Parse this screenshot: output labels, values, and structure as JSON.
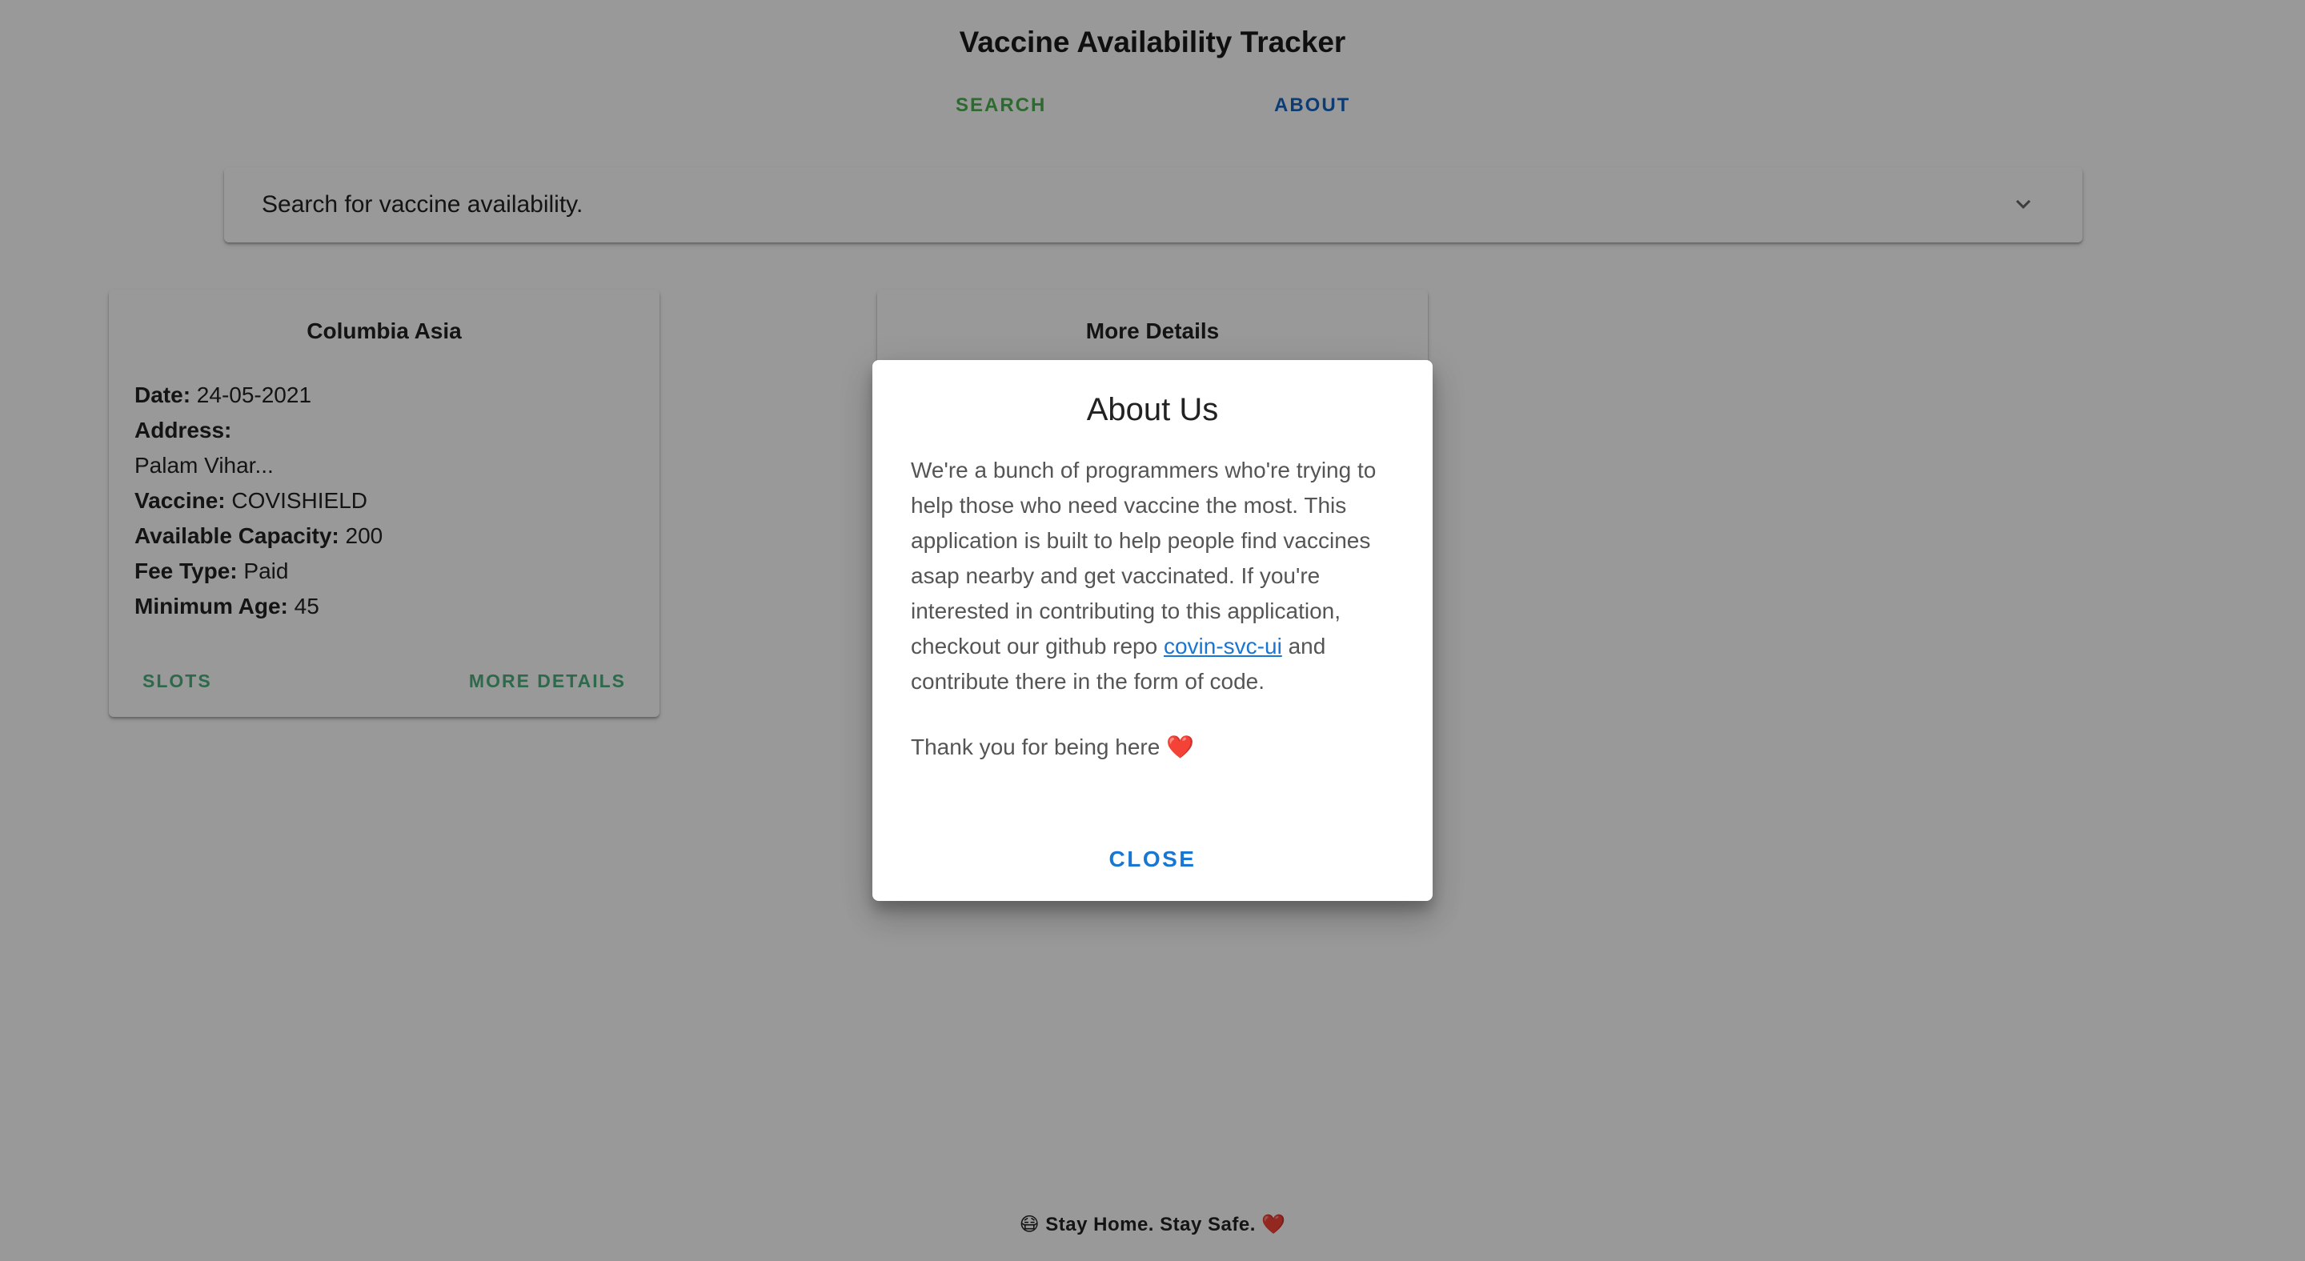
{
  "header": {
    "title": "Vaccine Availability Tracker",
    "tabs": [
      {
        "label": "SEARCH"
      },
      {
        "label": "ABOUT"
      }
    ]
  },
  "search": {
    "label": "Search for vaccine availability."
  },
  "cards": [
    {
      "title": "Columbia Asia",
      "fields": {
        "date_label": "Date:",
        "date_value": "24-05-2021",
        "address_label": "Address:",
        "address_value": "Palam Vihar...",
        "vaccine_label": "Vaccine:",
        "vaccine_value": "COVISHIELD",
        "capacity_label": "Available Capacity:",
        "capacity_value": "200",
        "fee_label": "Fee Type:",
        "fee_value": "Paid",
        "age_label": "Minimum Age:",
        "age_value": "45"
      },
      "actions": {
        "slots": "SLOTS",
        "more": "MORE DETAILS"
      }
    },
    {
      "title": "More Details"
    }
  ],
  "dialog": {
    "title": "About Us",
    "text_before_link": "We're a bunch of programmers who're trying to help those who need vaccine the most. This application is built to help people find vaccines asap nearby and get vaccinated. If you're interested in contributing to this application, checkout our github repo ",
    "link_text": "covin-svc-ui",
    "text_after_link": " and contribute there in the form of code.",
    "thanks": "Thank you for being here ❤️",
    "close_label": "CLOSE"
  },
  "footer": {
    "text": "😷 Stay Home. Stay Safe. ❤️"
  },
  "colors": {
    "search_tab": "#4caf50",
    "about_tab": "#1565c0",
    "card_action": "#4caf7d",
    "link": "#1976d2"
  }
}
